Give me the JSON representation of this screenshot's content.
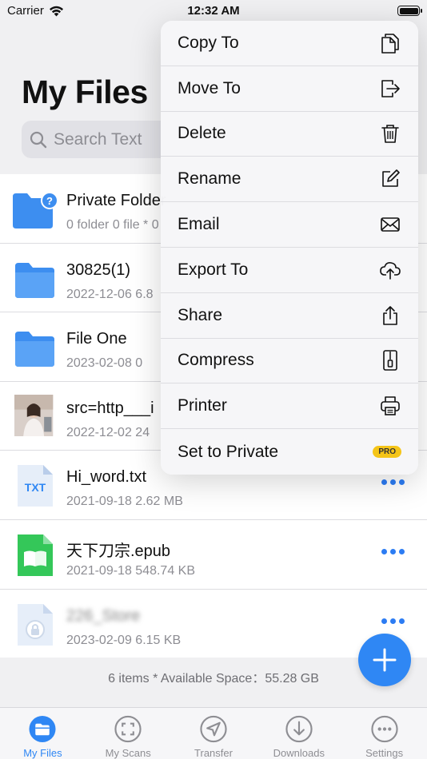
{
  "status": {
    "carrier": "Carrier",
    "time": "12:32 AM"
  },
  "header": {
    "title": "My Files"
  },
  "search": {
    "placeholder": "Search Text"
  },
  "files": [
    {
      "name": "Private Folder",
      "meta": "0 folder 0 file * 0",
      "icon": "private-folder-icon"
    },
    {
      "name": "30825(1)",
      "meta": "2022-12-06 6.8",
      "icon": "folder-icon"
    },
    {
      "name": "File One",
      "meta": "2023-02-08 0",
      "icon": "folder-icon"
    },
    {
      "name": "src=http___i",
      "meta": "2022-12-02 24",
      "icon": "photo-thumbnail"
    },
    {
      "name": "Hi_word.txt",
      "meta": "2021-09-18 2.62 MB",
      "icon": "txt-file-icon",
      "badge": "TXT"
    },
    {
      "name": "天下刀宗.epub",
      "meta": "2021-09-18 548.74 KB",
      "icon": "epub-file-icon"
    },
    {
      "name": "226_Store",
      "meta": "2023-02-09 6.15 KB",
      "icon": "locked-file-icon"
    }
  ],
  "footer": {
    "summary": "6 items * Available Space：55.28 GB"
  },
  "tabs": [
    {
      "label": "My Files",
      "icon": "folder-icon"
    },
    {
      "label": "My Scans",
      "icon": "scan-icon"
    },
    {
      "label": "Transfer",
      "icon": "send-icon"
    },
    {
      "label": "Downloads",
      "icon": "download-icon"
    },
    {
      "label": "Settings",
      "icon": "more-icon"
    }
  ],
  "menu": {
    "items": [
      {
        "label": "Copy To",
        "icon": "copy-icon"
      },
      {
        "label": "Move To",
        "icon": "move-icon"
      },
      {
        "label": "Delete",
        "icon": "trash-icon"
      },
      {
        "label": "Rename",
        "icon": "edit-icon"
      },
      {
        "label": "Email",
        "icon": "envelope-icon"
      },
      {
        "label": "Export To",
        "icon": "cloud-upload-icon"
      },
      {
        "label": "Share",
        "icon": "share-icon"
      },
      {
        "label": "Compress",
        "icon": "zip-icon"
      },
      {
        "label": "Printer",
        "icon": "printer-icon"
      },
      {
        "label": "Set to Private",
        "icon": "pro-badge"
      }
    ],
    "pro_label": "PRO"
  },
  "colors": {
    "accent": "#2f87f4",
    "folder": "#3d8ef0",
    "epub": "#34c759",
    "pro": "#f5c518"
  }
}
